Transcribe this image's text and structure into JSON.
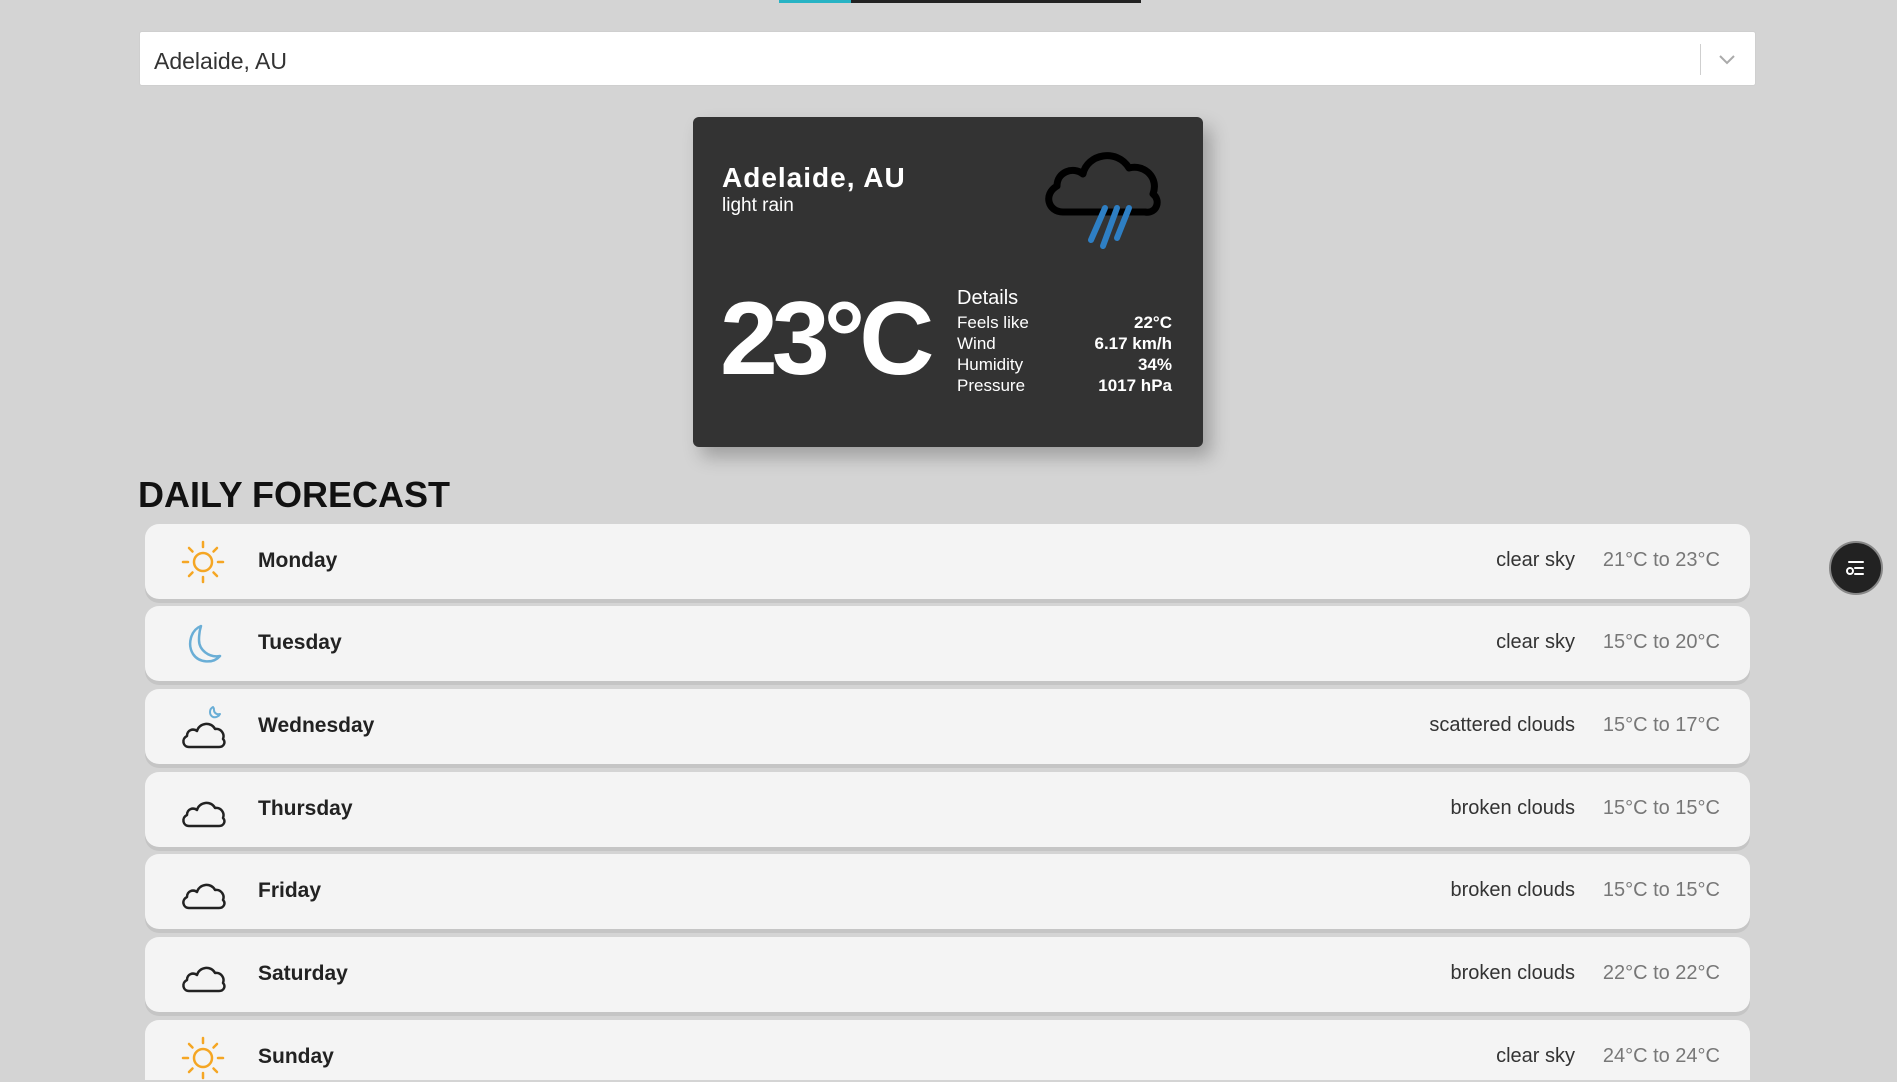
{
  "loading_progress": 0.2,
  "search": {
    "selected": "Adelaide, AU"
  },
  "current": {
    "city": "Adelaide, AU",
    "description": "light rain",
    "icon": "rain-cloud-icon",
    "temperature": "23°C",
    "details_title": "Details",
    "details": [
      {
        "label": "Feels like",
        "value": "22°C"
      },
      {
        "label": "Wind",
        "value": "6.17 km/h"
      },
      {
        "label": "Humidity",
        "value": "34%"
      },
      {
        "label": "Pressure",
        "value": "1017 hPa"
      }
    ]
  },
  "forecast": {
    "title": "DAILY FORECAST",
    "days": [
      {
        "day": "Monday",
        "description": "clear sky",
        "range": "21°C to 23°C",
        "icon": "sun-icon"
      },
      {
        "day": "Tuesday",
        "description": "clear sky",
        "range": "15°C to 20°C",
        "icon": "moon-icon"
      },
      {
        "day": "Wednesday",
        "description": "scattered clouds",
        "range": "15°C to 17°C",
        "icon": "cloud-moon-icon"
      },
      {
        "day": "Thursday",
        "description": "broken clouds",
        "range": "15°C to 15°C",
        "icon": "cloud-icon"
      },
      {
        "day": "Friday",
        "description": "broken clouds",
        "range": "15°C to 15°C",
        "icon": "cloud-icon"
      },
      {
        "day": "Saturday",
        "description": "broken clouds",
        "range": "22°C to 22°C",
        "icon": "cloud-icon"
      },
      {
        "day": "Sunday",
        "description": "clear sky",
        "range": "24°C to 24°C",
        "icon": "sun-icon"
      }
    ]
  },
  "colors": {
    "accent": "#27b3c4",
    "sun": "#f5a623",
    "moon": "#6aaed6",
    "rain": "#2e7fc4",
    "card": "#333333"
  },
  "floating_button": {
    "icon": "theme-settings-icon"
  }
}
